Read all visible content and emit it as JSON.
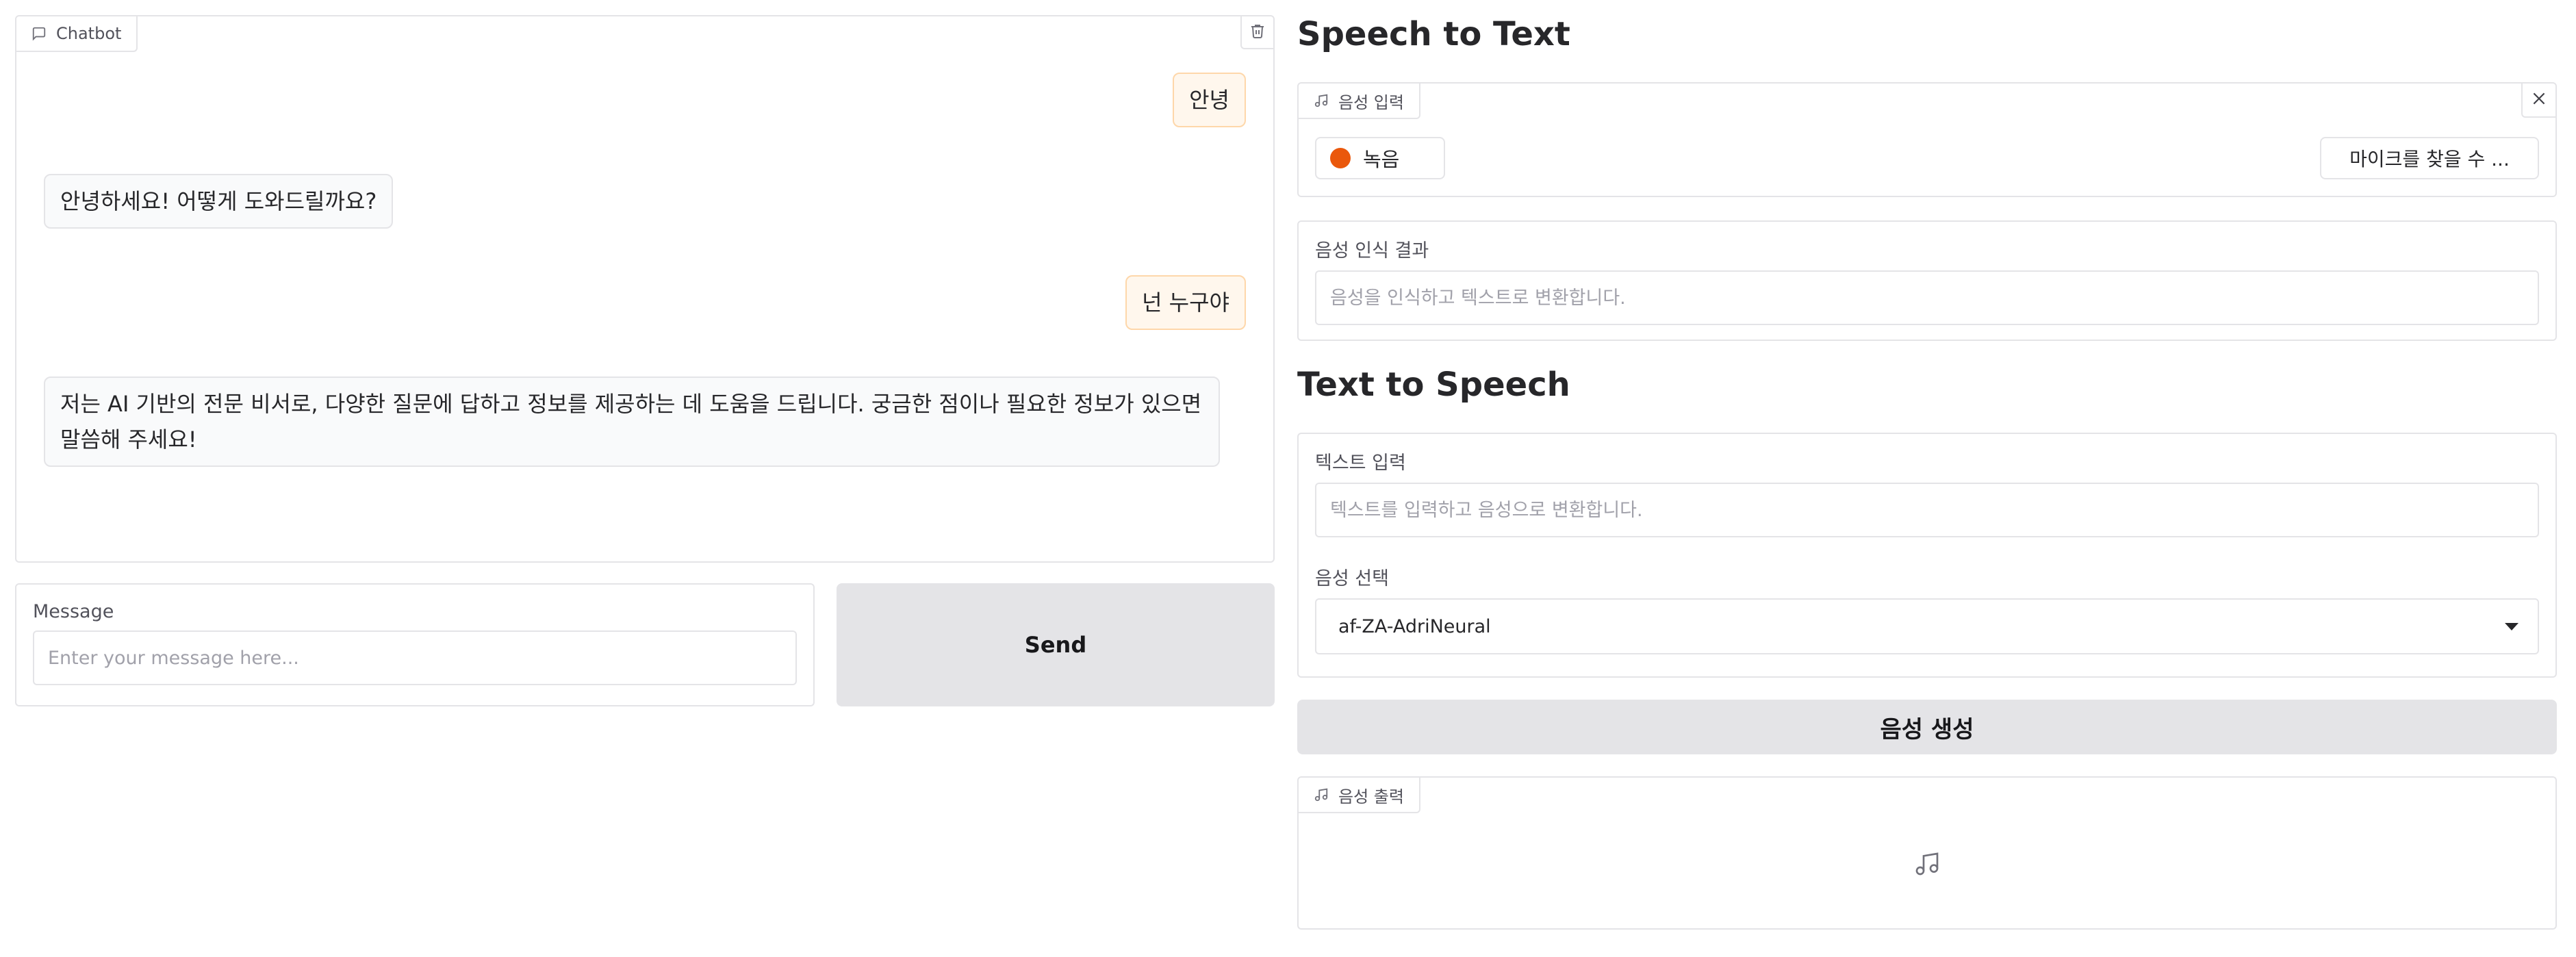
{
  "chatbot": {
    "label": "Chatbot",
    "messages": [
      {
        "role": "user",
        "text": "안녕"
      },
      {
        "role": "bot",
        "text": "안녕하세요! 어떻게 도와드릴까요?"
      },
      {
        "role": "user",
        "text": "넌 누구야"
      },
      {
        "role": "bot",
        "text": "저는 AI 기반의 전문 비서로, 다양한 질문에 답하고 정보를 제공하는 데 도움을 드립니다. 궁금한 점이나 필요한 정보가 있으면 말씀해 주세요!"
      }
    ]
  },
  "message_box": {
    "label": "Message",
    "placeholder": "Enter your message here...",
    "value": ""
  },
  "send_button": "Send",
  "stt": {
    "title": "Speech to Text",
    "audio_label": "음성 입력",
    "record_label": "녹음",
    "mic_label": "마이크를 찾을 수 ...",
    "result_label": "음성 인식 결과",
    "result_placeholder": "음성을 인식하고 텍스트로 변환합니다."
  },
  "tts": {
    "title": "Text to Speech",
    "text_label": "텍스트 입력",
    "text_placeholder": "텍스트를 입력하고 음성으로 변환합니다.",
    "voice_label": "음성 선택",
    "voice_value": "af-ZA-AdriNeural",
    "generate_label": "음성 생성",
    "output_label": "음성 출력"
  },
  "colors": {
    "record_dot": "#ea580c",
    "user_bubble": "#fff7ed",
    "bot_bubble": "#f9fafb",
    "button_bg": "#e4e4e7"
  },
  "icons": {
    "chatbot": "chat-icon",
    "trash": "trash-icon",
    "audio": "music-note-icon",
    "close": "close-icon",
    "dropdown": "chevron-down-icon"
  }
}
